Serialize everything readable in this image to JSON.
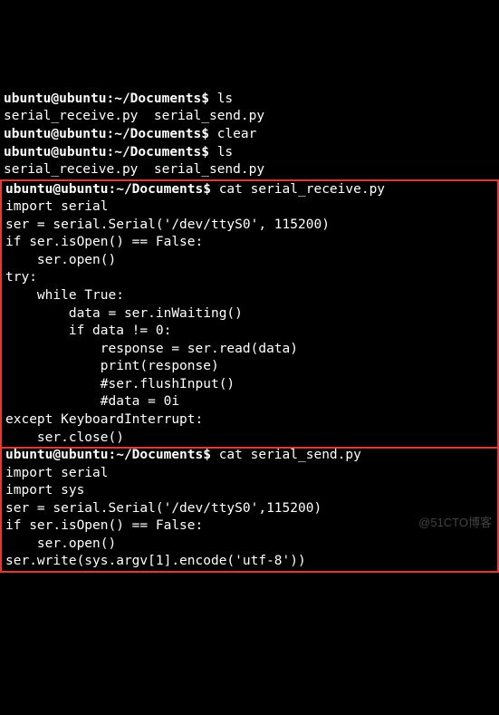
{
  "prompt1": "ubuntu@ubuntu:~/Documents$ ",
  "cmd_ls1": "ls",
  "out_ls1": "serial_receive.py  serial_send.py",
  "cmd_clear": "clear",
  "cmd_ls2": "ls",
  "out_ls2": "serial_receive.py  serial_send.py",
  "box1": {
    "cmd": "cat serial_receive.py",
    "lines": [
      "import serial",
      "ser = serial.Serial('/dev/ttyS0', 115200)",
      "if ser.isOpen() == False:",
      "    ser.open()",
      "try:",
      "    while True:",
      "        data = ser.inWaiting()",
      "        if data != 0:",
      "            response = ser.read(data)",
      "            print(response)",
      "            #ser.flushInput()",
      "            #data = 0i",
      "except KeyboardInterrupt:",
      "    ser.close()"
    ]
  },
  "box2": {
    "cmd": "cat serial_send.py",
    "lines": [
      "import serial",
      "import sys",
      "ser = serial.Serial('/dev/ttyS0',115200)",
      "if ser.isOpen() == False:",
      "    ser.open()",
      "ser.write(sys.argv[1].encode('utf-8'))"
    ]
  },
  "watermark": "@51CTO博客"
}
